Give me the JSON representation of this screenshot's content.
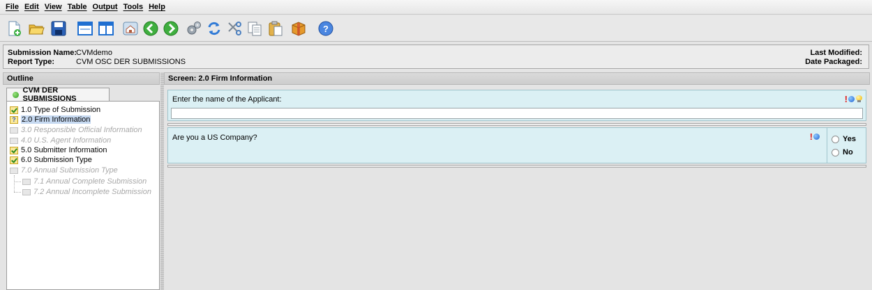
{
  "menu": [
    "File",
    "Edit",
    "View",
    "Table",
    "Output",
    "Tools",
    "Help"
  ],
  "toolbar_icons": [
    "new-document-icon",
    "open-folder-icon",
    "save-icon",
    "window-icon",
    "split-view-icon",
    "home-icon",
    "back-arrow-icon",
    "forward-arrow-icon",
    "gears-icon",
    "refresh-icon",
    "cut-icon",
    "copy-icon",
    "paste-icon",
    "package-icon",
    "help-icon"
  ],
  "info": {
    "submission_name_label": "Submission Name:",
    "submission_name": "CVMdemo",
    "report_type_label": "Report Type:",
    "report_type": "CVM OSC DER SUBMISSIONS",
    "last_modified_label": "Last Modified:",
    "date_packaged_label": "Date Packaged:"
  },
  "outline": {
    "header": "Outline",
    "tab": "CVM DER SUBMISSIONS",
    "items": [
      {
        "label": "1.0 Type of Submission",
        "status": "complete"
      },
      {
        "label": "2.0 Firm Information",
        "status": "incomplete-selected"
      },
      {
        "label": "3.0 Responsible Official Information",
        "status": "disabled"
      },
      {
        "label": "4.0 U.S. Agent Information",
        "status": "disabled"
      },
      {
        "label": "5.0 Submitter Information",
        "status": "complete"
      },
      {
        "label": "6.0 Submission Type",
        "status": "complete"
      },
      {
        "label": "7.0 Annual Submission Type",
        "status": "disabled"
      },
      {
        "label": "7.1 Annual Complete Submission",
        "status": "disabled"
      },
      {
        "label": "7.2 Annual Incomplete Submission",
        "status": "disabled"
      }
    ]
  },
  "screen": {
    "header": "Screen: 2.0 Firm Information",
    "q1": {
      "text": "Enter the name of the Applicant:",
      "value": ""
    },
    "q2": {
      "text": "Are you a US Company?",
      "options": [
        "Yes",
        "No"
      ],
      "selected": null
    }
  },
  "colors": {
    "question_bg": "#dbf0f4",
    "selected_bg": "#c6d9f1",
    "required_red": "#e01c1c",
    "status_green": "#2f9b1f"
  }
}
